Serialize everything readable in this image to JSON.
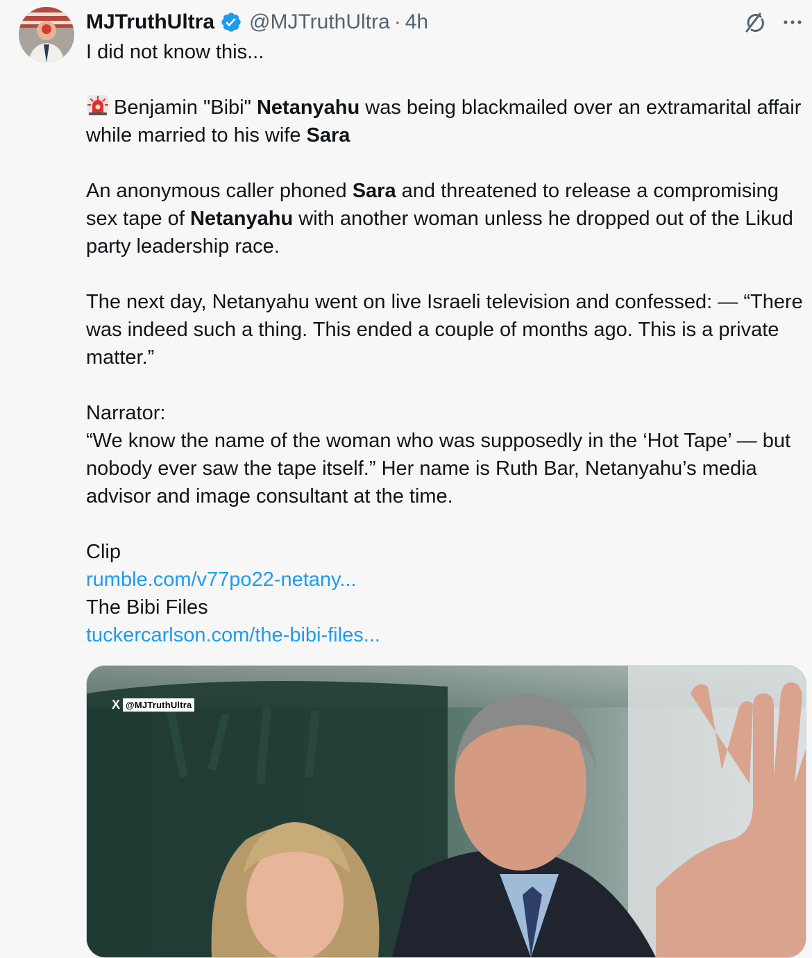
{
  "tweet": {
    "display_name": "MJTruthUltra",
    "handle": "@MJTruthUltra",
    "separator": "·",
    "time": "4h",
    "verified_icon": "verified-badge-icon",
    "grok_icon": "grok-icon",
    "more_icon": "more-icon",
    "accent_color": "#1d9bf0",
    "body": {
      "line1": "I did not know this...",
      "p2_part1": "Benjamin \"Bibi\" ",
      "p2_bold1": "Netanyahu",
      "p2_part2": " was being blackmailed over an extramarital affair while married to his wife ",
      "p2_bold2": "Sara",
      "p3_part1": "An anonymous caller phoned ",
      "p3_bold1": "Sara",
      "p3_part2": " and threatened to release a compromising sex tape of ",
      "p3_bold2": "Netanyahu",
      "p3_part3": " with another woman unless he dropped out of the Likud party leadership race.",
      "p4": "The next day, Netanyahu went on live Israeli television and confessed: — “There was indeed such a thing. This ended a couple of months ago. This is a private matter.”",
      "p5_line1": "Narrator:",
      "p5_line2": "“We know the name of the woman who was supposedly in the ‘Hot Tape’ — but nobody ever saw the tape itself.” Her name is Ruth Bar, Netanyahu’s media advisor and image consultant at the time.",
      "clip_label": "Clip",
      "clip_link": "rumble.com/v77po22-netany...",
      "files_label": "The Bibi Files",
      "files_link": "tuckercarlson.com/the-bibi-files..."
    },
    "media": {
      "watermark_logo": "X",
      "watermark_handle": "@MJTruthUltra"
    }
  }
}
